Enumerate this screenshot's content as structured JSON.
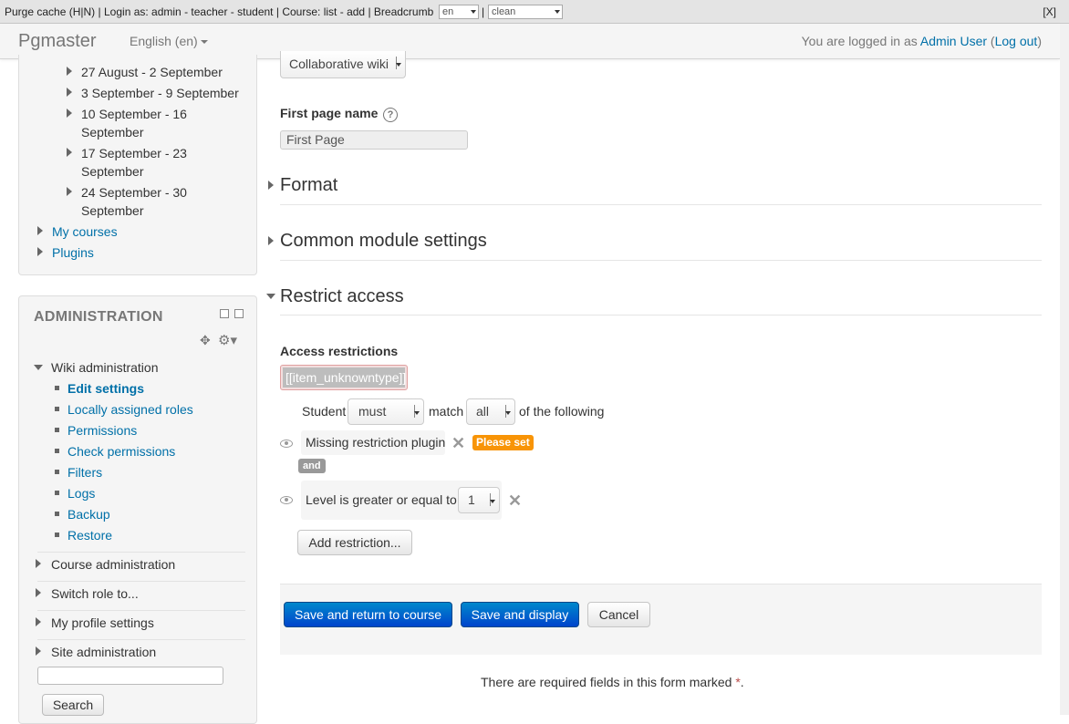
{
  "devbar": {
    "purge": "Purge cache",
    "hn": "(H|N)",
    "login_as": "Login as:",
    "users": [
      "admin",
      "teacher",
      "student"
    ],
    "course_label": "Course:",
    "course_links": [
      "list",
      "add"
    ],
    "breadcrumb": "Breadcrumb",
    "lang_select": "en",
    "theme_select": "clean",
    "close": "[X]"
  },
  "navbar": {
    "brand": "Pgmaster",
    "language": "English (en)",
    "logged_in_prefix": "You are logged in as",
    "user": "Admin User",
    "logout": "Log out"
  },
  "navigation": {
    "weeks": [
      {
        "line1": "27 August - 2 September",
        "line2": ""
      },
      {
        "line1": "3 September - 9 September",
        "line2": ""
      },
      {
        "line1": "10 September - 16",
        "line2": "September"
      },
      {
        "line1": "17 September - 23",
        "line2": "September"
      },
      {
        "line1": "24 September - 30",
        "line2": "September"
      }
    ],
    "my_courses": "My courses",
    "plugins": "Plugins"
  },
  "administration": {
    "title": "ADMINISTRATION",
    "wiki_admin": "Wiki administration",
    "wiki_items": [
      "Edit settings",
      "Locally assigned roles",
      "Permissions",
      "Check permissions",
      "Filters",
      "Logs",
      "Backup",
      "Restore"
    ],
    "sections": [
      "Course administration",
      "Switch role to...",
      "My profile settings",
      "Site administration"
    ],
    "search_button": "Search"
  },
  "form": {
    "wiki_mode_value": "Collaborative wiki",
    "first_page_label": "First page name",
    "first_page_value": "First Page",
    "sections": {
      "format": "Format",
      "common": "Common module settings",
      "restrict": "Restrict access"
    },
    "access_restrictions_label": "Access restrictions",
    "unknown_type": "[[item_unknowntype]]",
    "student_label": "Student",
    "must_value": "must",
    "match_label": "match",
    "all_value": "all",
    "of_following": "of the following",
    "missing_plugin": "Missing restriction plugin",
    "please_set": "Please set",
    "and_badge": "and",
    "level_label": "Level is greater or equal to",
    "level_value": "1",
    "add_restriction": "Add restriction...",
    "save_return": "Save and return to course",
    "save_display": "Save and display",
    "cancel": "Cancel",
    "required_note": "There are required fields in this form marked",
    "required_star": "*",
    "required_end": "."
  }
}
